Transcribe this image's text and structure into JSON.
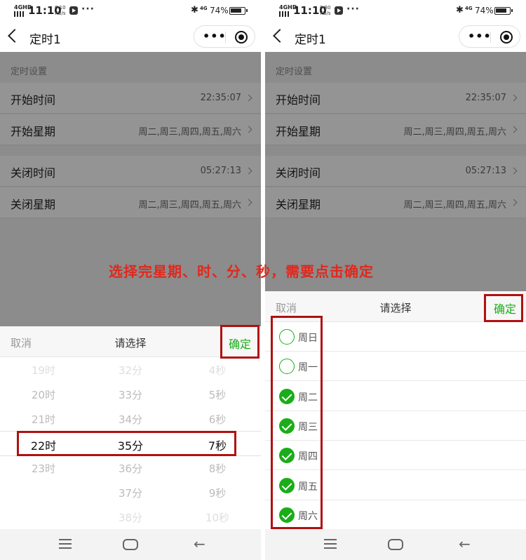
{
  "status": {
    "signal": "4GHD",
    "time": "11:10",
    "left_speed_value": "0.10",
    "right_speed_value": "0.80",
    "speed_unit": "KB/s",
    "more": "···",
    "bluetooth": "✱",
    "network": "4G",
    "battery": "74%"
  },
  "nav": {
    "title": "定时1",
    "more_dots": "•••"
  },
  "settings": {
    "section": "定时设置",
    "start_time_label": "开始时间",
    "start_time_value": "22:35:07",
    "start_week_label": "开始星期",
    "start_week_value": "周二,周三,周四,周五,周六",
    "stop_time_label": "关闭时间",
    "stop_time_value": "05:27:13",
    "stop_week_label": "关闭星期",
    "stop_week_value": "周二,周三,周四,周五,周六"
  },
  "sheet": {
    "cancel": "取消",
    "prompt": "请选择",
    "confirm": "确定"
  },
  "picker": {
    "rows": [
      [
        "19时",
        "32分",
        "4秒"
      ],
      [
        "20时",
        "33分",
        "5秒"
      ],
      [
        "21时",
        "34分",
        "6秒"
      ],
      [
        "22时",
        "35分",
        "7秒"
      ],
      [
        "23时",
        "36分",
        "8秒"
      ],
      [
        "",
        "37分",
        "9秒"
      ],
      [
        "",
        "38分",
        "10秒"
      ]
    ],
    "selected_index": 3
  },
  "weekdays": [
    {
      "label": "周日",
      "checked": false
    },
    {
      "label": "周一",
      "checked": false
    },
    {
      "label": "周二",
      "checked": true
    },
    {
      "label": "周三",
      "checked": true
    },
    {
      "label": "周四",
      "checked": true
    },
    {
      "label": "周五",
      "checked": true
    },
    {
      "label": "周六",
      "checked": true
    }
  ],
  "annotation": "选择完星期、时、分、秒，需要点击确定",
  "colors": {
    "accent": "#1aad19",
    "highlight_box": "#b11010",
    "annotation": "#e0281d"
  }
}
